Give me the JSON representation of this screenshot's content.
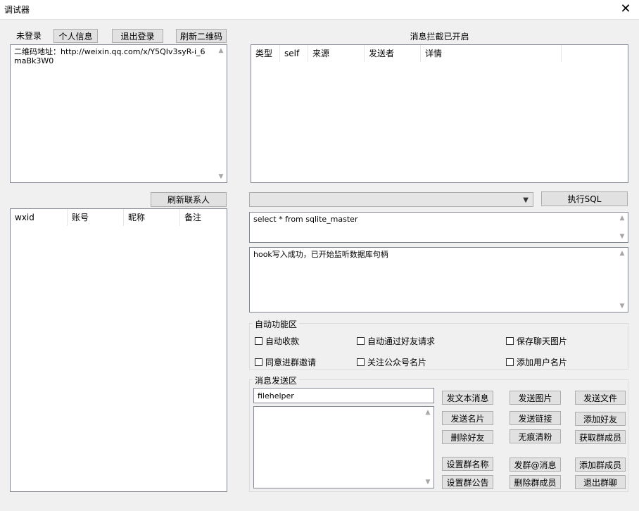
{
  "window": {
    "title": "调试器",
    "close_label": "✕"
  },
  "login": {
    "status": "未登录",
    "buttons": {
      "profile": "个人信息",
      "logout": "退出登录",
      "refresh_qr": "刷新二维码"
    },
    "qr_text": "二维码地址：http://weixin.qq.com/x/Y5QIv3syR-i_6maBk3W0"
  },
  "contacts": {
    "refresh_button": "刷新联系人",
    "columns": [
      "wxid",
      "账号",
      "昵称",
      "备注"
    ]
  },
  "messages": {
    "status": "消息拦截已开启",
    "columns": [
      "类型",
      "self",
      "来源",
      "发送者",
      "详情"
    ]
  },
  "sql": {
    "dropdown_value": "",
    "execute_button": "执行SQL",
    "query": "select * from sqlite_master",
    "log": "hook写入成功，已开始监听数据库句柄"
  },
  "auto": {
    "title": "自动功能区",
    "options": {
      "auto_receive": "自动收款",
      "auto_accept_friend": "自动通过好友请求",
      "save_images": "保存聊天图片",
      "accept_group_invite": "同意进群邀请",
      "follow_official_card": "关注公众号名片",
      "add_user_card": "添加用户名片"
    }
  },
  "send": {
    "title": "消息发送区",
    "target": "filehelper",
    "message": "",
    "buttons": {
      "send_text": "发文本消息",
      "send_image": "发送图片",
      "send_file": "发送文件",
      "send_card": "发送名片",
      "send_link": "发送链接",
      "add_friend": "添加好友",
      "delete_friend": "删除好友",
      "silent_unfriend": "无痕清粉",
      "get_members": "获取群成员",
      "set_group_name": "设置群名称",
      "group_at": "发群@消息",
      "add_member": "添加群成员",
      "set_announcement": "设置群公告",
      "remove_member": "删除群成员",
      "quit_group": "退出群聊"
    }
  }
}
